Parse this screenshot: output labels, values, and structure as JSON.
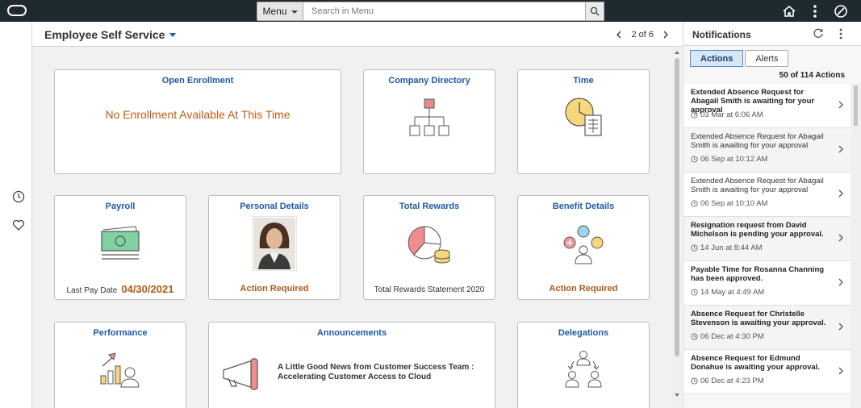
{
  "topbar": {
    "menu_label": "Menu",
    "search_placeholder": "Search in Menu"
  },
  "header": {
    "title": "Employee Self Service",
    "pager_text": "2 of 6"
  },
  "tiles": {
    "open_enrollment": {
      "title": "Open Enrollment",
      "message": "No Enrollment Available At This Time"
    },
    "company_directory": {
      "title": "Company Directory"
    },
    "time": {
      "title": "Time"
    },
    "payroll": {
      "title": "Payroll",
      "footer_label": "Last Pay Date",
      "footer_value": "04/30/2021"
    },
    "personal_details": {
      "title": "Personal Details",
      "footer": "Action Required"
    },
    "total_rewards": {
      "title": "Total Rewards",
      "footer": "Total Rewards Statement 2020"
    },
    "benefit_details": {
      "title": "Benefit Details",
      "footer": "Action Required"
    },
    "performance": {
      "title": "Performance"
    },
    "announcements": {
      "title": "Announcements",
      "text": "A Little Good News from Customer Success Team : Accelerating Customer Access to Cloud"
    },
    "delegations": {
      "title": "Delegations"
    }
  },
  "notifications": {
    "title": "Notifications",
    "tabs": [
      "Actions",
      "Alerts"
    ],
    "count": "50 of 114 Actions",
    "items": [
      {
        "text": "Extended Absence Request for Abagail Smith is awaiting for your approval",
        "time": "03 Mar at 6:06 AM",
        "bold": true
      },
      {
        "text": "Extended Absence Request for Abagail Smith is awaiting for your approval",
        "time": "06 Sep at 10:12 AM",
        "bold": false
      },
      {
        "text": "Extended Absence Request for Abagail Smith is awaiting for your approval",
        "time": "06 Sep at 10:10 AM",
        "bold": false
      },
      {
        "text": "Resignation request from David Michelson is pending your approval.",
        "time": "14 Jun at 8:44 AM",
        "bold": true
      },
      {
        "text": "Payable Time for Rosanna Channing has been approved.",
        "time": "14 May at 4:49 AM",
        "bold": true
      },
      {
        "text": "Absence Request for Christelle Stevenson is awaiting your approval.",
        "time": "06 Dec at 4:30 PM",
        "bold": true
      },
      {
        "text": "Absence Request for Edmund Donahue is awaiting your approval.",
        "time": "06 Dec at 4:23 PM",
        "bold": true
      }
    ]
  },
  "colors": {
    "topbar": "#1f2a30",
    "link_blue": "#1f5aa5",
    "action_orange": "#b05a1a"
  }
}
